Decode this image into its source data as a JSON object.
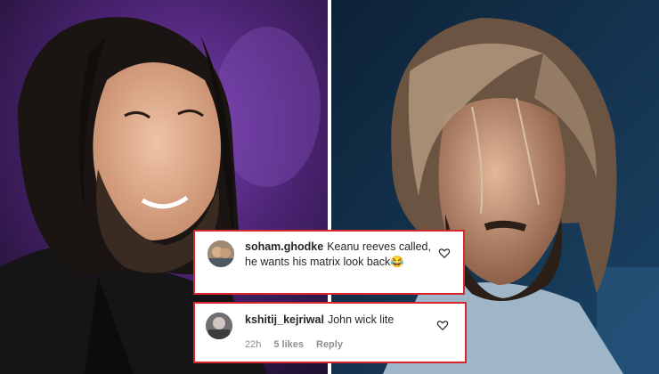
{
  "comments": [
    {
      "username": "soham.ghodke",
      "text": "Keanu reeves called, he wants his matrix look back😂"
    },
    {
      "username": "kshitij_kejriwal",
      "text": "John wick lite",
      "time": "22h",
      "likes": "5 likes",
      "reply": "Reply"
    }
  ],
  "icons": {
    "like": "heart-outline-icon"
  },
  "colors": {
    "highlight_border": "#d8262e",
    "username": "#262626",
    "meta": "#8e8e8e"
  }
}
